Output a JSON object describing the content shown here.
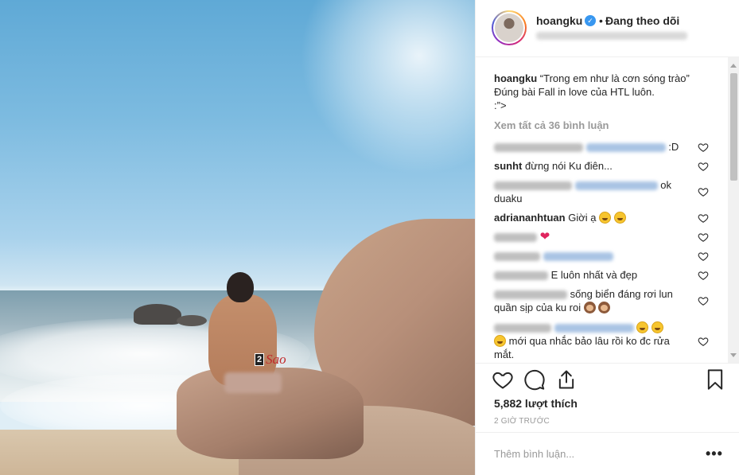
{
  "post": {
    "username": "hoangku",
    "follow_separator": "•",
    "follow_status": "Đang theo dõi",
    "verified_icon": "✓",
    "watermark_box": "2",
    "watermark_text": "Sao"
  },
  "caption": {
    "username": "hoangku",
    "text_line1": "“Trong em như là cơn sóng trào”",
    "text_line2": "Đúng bài Fall in love của HTL luôn.",
    "text_line3": ":”>"
  },
  "view_all_comments": "Xem tất cả 36 bình luận",
  "comments": [
    {
      "username": "",
      "text": ":D"
    },
    {
      "username": "sunht",
      "text": "đừng nói Ku điên..."
    },
    {
      "username": "",
      "text": "ok duaku"
    },
    {
      "username": "adriananhtuan",
      "text": "Giời ạ"
    },
    {
      "username": "",
      "text": ""
    },
    {
      "username": "",
      "text": ""
    },
    {
      "username": "",
      "text": "E luôn nhất và đẹp"
    },
    {
      "username": "",
      "text": "sống biển đáng rơi lun quần sịp của ku roi"
    },
    {
      "username": "",
      "text": "mới qua nhắc bảo lâu rồi ko đc rửa mắt."
    }
  ],
  "likes": "5,882 lượt thích",
  "timestamp": "2 GIỜ TRƯỚC",
  "add_comment_placeholder": "Thêm bình luận...",
  "more_options": "•••",
  "colors": {
    "verified": "#3897f0",
    "heart_red": "#e0245e",
    "muted": "#999999",
    "text": "#262626"
  },
  "icons": [
    "heart-icon",
    "comment-icon",
    "share-icon",
    "bookmark-icon",
    "more-options-icon"
  ]
}
